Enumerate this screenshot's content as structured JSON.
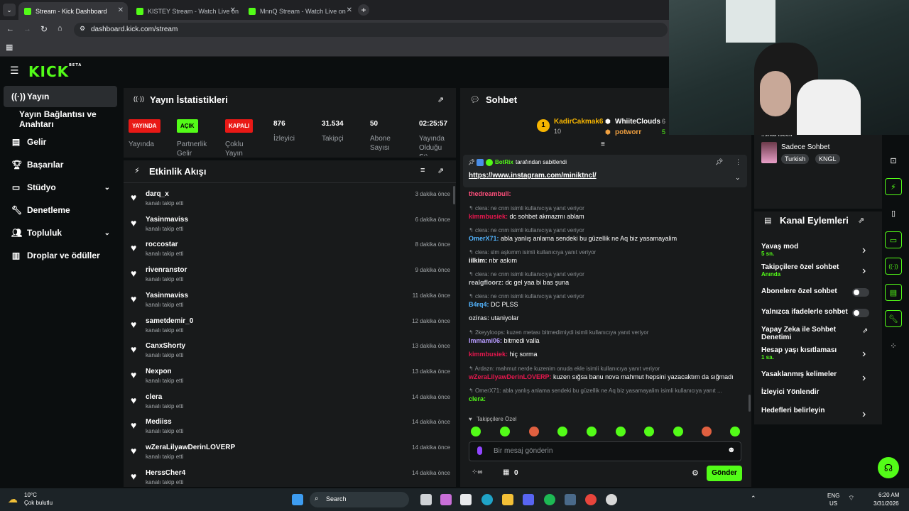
{
  "browser": {
    "tabs": [
      {
        "label": "Stream - Kick Dashboard"
      },
      {
        "label": "KISTEY Stream - Watch Live on"
      },
      {
        "label": "MnnQ Stream - Watch Live on"
      }
    ],
    "url": "dashboard.kick.com/stream"
  },
  "brand": {
    "logo": "KICK",
    "beta": "BETA",
    "accent": "#53fc18"
  },
  "sidebar": {
    "items": [
      {
        "label": "Yayın",
        "icon": "broadcast-icon"
      },
      {
        "label": "Yayın Bağlantısı ve Anahtarı",
        "icon": ""
      },
      {
        "label": "Gelir",
        "icon": "revenue-icon"
      },
      {
        "label": "Başarılar",
        "icon": "trophy-icon"
      },
      {
        "label": "Stüdyo",
        "icon": "studio-icon"
      },
      {
        "label": "Denetleme",
        "icon": "wrench-icon"
      },
      {
        "label": "Topluluk",
        "icon": "community-icon"
      },
      {
        "label": "Droplar ve ödüller",
        "icon": "drops-icon"
      }
    ]
  },
  "stats": {
    "title": "Yayın İstatistikleri",
    "items": [
      {
        "badge": "YAYINDA",
        "label": "Yayında"
      },
      {
        "badge": "AÇIK",
        "label": "Partnerlik Gelir"
      },
      {
        "badge": "KAPALI",
        "label": "Çoklu Yayın"
      },
      {
        "value": "876",
        "label": "İzleyici"
      },
      {
        "value": "31.534",
        "label": "Takipçi"
      },
      {
        "value": "50",
        "label": "Abone Sayısı"
      },
      {
        "value": "02:25:57",
        "label": "Yayında Olduğu Sü..."
      }
    ]
  },
  "activity": {
    "title": "Etkinlik Akışı",
    "action": "kanalı takip etti",
    "rows": [
      {
        "name": "darq_x",
        "time": "3 dakika önce"
      },
      {
        "name": "Yasinmaviss",
        "time": "6 dakika önce"
      },
      {
        "name": "roccostar",
        "time": "8 dakika önce"
      },
      {
        "name": "rivenranstor",
        "time": "9 dakika önce"
      },
      {
        "name": "Yasinmaviss",
        "time": "11 dakika önce"
      },
      {
        "name": "sametdemir_0",
        "time": "12 dakika önce"
      },
      {
        "name": "CanxShorty",
        "time": "13 dakika önce"
      },
      {
        "name": "Nexpon",
        "time": "13 dakika önce"
      },
      {
        "name": "clera",
        "time": "14 dakika önce"
      },
      {
        "name": "Mediiss",
        "time": "14 dakika önce"
      },
      {
        "name": "wZeraLilyawDerinLOVERP",
        "time": "14 dakika önce"
      },
      {
        "name": "HerssCher4",
        "time": "14 dakika önce"
      }
    ]
  },
  "chat": {
    "title": "Sohbet",
    "top": [
      {
        "name": "KadirCakmak6",
        "value": "10"
      },
      {
        "name": "WhiiteClouds",
        "value": "6"
      },
      {
        "name": "potworr",
        "value": "5"
      }
    ],
    "pinned": {
      "by": "BotRix",
      "by_suffix": "tarafından sabitlendi",
      "link": "https://www.instagram.com/miniktncl/"
    },
    "messages": [
      {
        "reply": "",
        "user": "thedreambull",
        "color": "#ff4f7b",
        "text": ""
      },
      {
        "reply": "clera: ne cnm isimli kullanıcıya yanıt veriyor",
        "user": "kimmbusiek",
        "color": "#e8174e",
        "text": "dc sohbet akmazmı ablam"
      },
      {
        "reply": "clera: ne cnm isimli kullanıcıya yanıt veriyor",
        "user": "OmerX71",
        "color": "#53b5ff",
        "text": "abla yanlış anlama sendeki bu güzellik ne Aq biz yasamayalim"
      },
      {
        "reply": "clera: slm aşkımm isimli kullanıcıya yanıt veriyor",
        "user": "iilkim",
        "color": "#ffffff",
        "text": "nbr askım"
      },
      {
        "reply": "clera: ne cnm isimli kullanıcıya yanıt veriyor",
        "user": "realgfloorz",
        "color": "#c7c9cb",
        "text": "dc gel yaa bi bas şuna"
      },
      {
        "reply": "clera: ne cnm isimli kullanıcıya yanıt veriyor",
        "user": "B4rq4",
        "color": "#53b5ff",
        "text": "DC PLSS"
      },
      {
        "reply": "",
        "user": "oziras",
        "color": "#c7c9cb",
        "text": "utaniyolar"
      },
      {
        "reply": "2keyyloops: kuzen metası bitmedimiydi isimli kullanıcıya yanıt veriyor",
        "user": "Immami06",
        "color": "#b79cff",
        "text": "bitmedi valla"
      },
      {
        "reply": "",
        "user": "kimmbusiek",
        "color": "#e8174e",
        "text": "hiç sorma"
      },
      {
        "reply": "Ardazn: mahmut nerde kuzenim onuda ekle isimli kullanıcıya yanıt veriyor",
        "user": "wZeraLilyawDerinLOVERP",
        "color": "#e8174e",
        "text": "kuzen sığsa banu nova mahmut hepsini yazacaktım da sığmadı"
      },
      {
        "reply": "OmerX71: abla yanlış anlama sendeki bu güzellik ne Aq biz yasamayalim isimli kullanıcıya yanıt ...",
        "user": "clera",
        "color": "#53fc18",
        "text": ""
      }
    ],
    "followers_only": "Takipçilere Özel",
    "input_placeholder": "Bir mesaj gönderin",
    "points": "0",
    "send": "Gönder"
  },
  "channel_info": {
    "heading": "...ıntu ıscell",
    "mode": "Sadece Sohbet",
    "tags": [
      "Turkish",
      "KNGL"
    ]
  },
  "actions": {
    "title": "Kanal Eylemleri",
    "items": [
      {
        "label": "Yavaş mod",
        "sub": "5 sn.",
        "control": "arrow"
      },
      {
        "label": "Takipçilere özel sohbet",
        "sub": "Anında",
        "control": "arrow"
      },
      {
        "label": "Abonelere özel sohbet",
        "sub": "",
        "control": "toggle"
      },
      {
        "label": "Yalnızca ifadelerle sohbet",
        "sub": "",
        "control": "toggle"
      },
      {
        "label": "Yapay Zeka ile Sohbet Denetimi",
        "sub": "",
        "control": "external"
      },
      {
        "label": "Hesap yaşı kısıtlaması",
        "sub": "1 sa.",
        "control": "arrow"
      },
      {
        "label": "Yasaklanmış kelimeler",
        "sub": "",
        "control": "arrow"
      },
      {
        "label": "İzleyici Yönlendir",
        "sub": "",
        "control": "none"
      },
      {
        "label": "Hedefleri belirleyin",
        "sub": "",
        "control": "arrow"
      }
    ]
  },
  "taskbar": {
    "weather_temp": "10°C",
    "weather_desc": "Çok bulutlu",
    "search": "Search",
    "lang": "ENG",
    "region": "US",
    "time": "6:20 AM",
    "date": "3/31/2026"
  }
}
